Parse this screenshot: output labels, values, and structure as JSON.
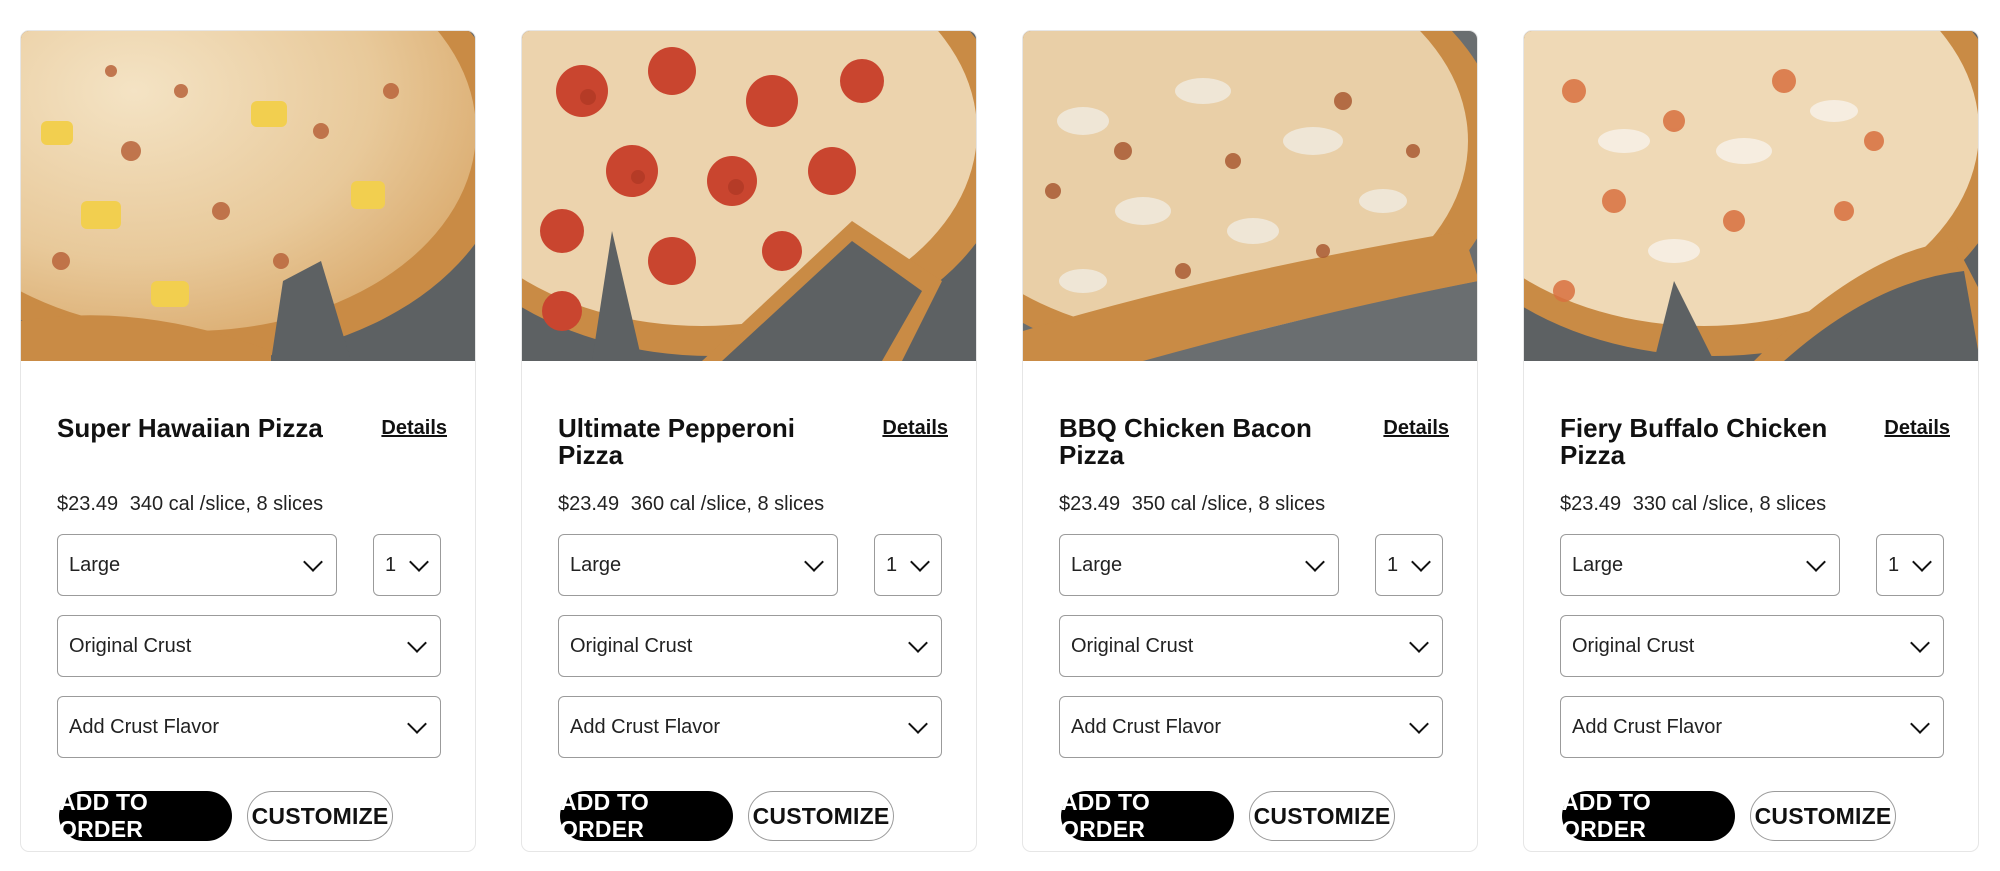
{
  "products": [
    {
      "name": "Super Hawaiian Pizza",
      "details_label": "Details",
      "price": "$23.49",
      "nutrition": "340 cal /slice, 8 slices",
      "size": "Large",
      "quantity": "1",
      "crust": "Original Crust",
      "crust_flavor": "Add Crust Flavor",
      "add_label": "ADD TO ORDER",
      "customize_label": "CUSTOMIZE",
      "image_icon": "pizza-hawaiian-photo"
    },
    {
      "name": "Ultimate Pepperoni Pizza",
      "details_label": "Details",
      "price": "$23.49",
      "nutrition": "360 cal /slice, 8 slices",
      "size": "Large",
      "quantity": "1",
      "crust": "Original Crust",
      "crust_flavor": "Add Crust Flavor",
      "add_label": "ADD TO ORDER",
      "customize_label": "CUSTOMIZE",
      "image_icon": "pizza-pepperoni-photo"
    },
    {
      "name": "BBQ Chicken Bacon Pizza",
      "details_label": "Details",
      "price": "$23.49",
      "nutrition": "350 cal /slice, 8 slices",
      "size": "Large",
      "quantity": "1",
      "crust": "Original Crust",
      "crust_flavor": "Add Crust Flavor",
      "add_label": "ADD TO ORDER",
      "customize_label": "CUSTOMIZE",
      "image_icon": "pizza-bbq-chicken-photo"
    },
    {
      "name": "Fiery Buffalo Chicken Pizza",
      "details_label": "Details",
      "price": "$23.49",
      "nutrition": "330 cal /slice, 8 slices",
      "size": "Large",
      "quantity": "1",
      "crust": "Original Crust",
      "crust_flavor": "Add Crust Flavor",
      "add_label": "ADD TO ORDER",
      "customize_label": "CUSTOMIZE",
      "image_icon": "pizza-buffalo-chicken-photo"
    }
  ],
  "colors": {
    "button_primary": "#000000",
    "button_primary_text": "#ffffff",
    "card_border": "#e6e6e6",
    "select_border": "#9b9b9b",
    "pan_background": "#5d6163"
  }
}
